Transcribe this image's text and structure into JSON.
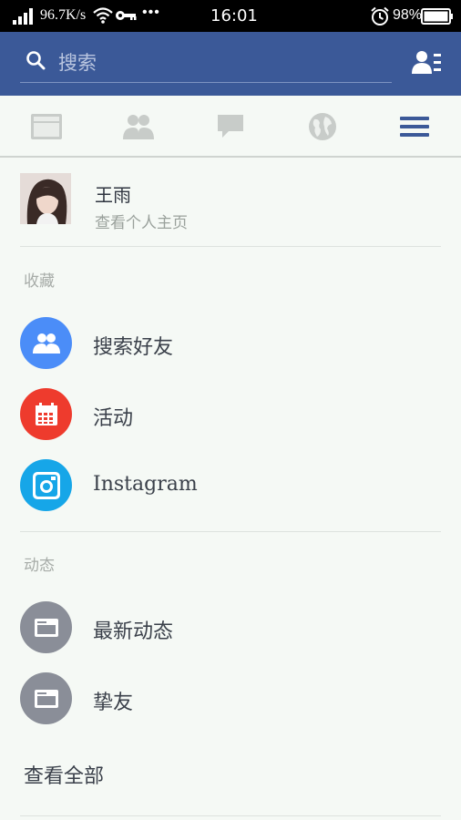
{
  "status_bar": {
    "speed": "96.7K/s",
    "dots": "•••",
    "time": "16:01",
    "battery_percent": "98%"
  },
  "header": {
    "search_placeholder": "搜索"
  },
  "tabs": [
    {
      "name": "news-feed",
      "icon": "news-feed-icon",
      "active": false
    },
    {
      "name": "friends",
      "icon": "friends-icon",
      "active": false
    },
    {
      "name": "messages",
      "icon": "chat-icon",
      "active": false
    },
    {
      "name": "notifications",
      "icon": "globe-icon",
      "active": false
    },
    {
      "name": "menu",
      "icon": "hamburger-menu-icon",
      "active": true
    }
  ],
  "profile": {
    "name": "王雨",
    "subtitle": "查看个人主页"
  },
  "sections": {
    "favorites_label": "收藏",
    "favorites": [
      {
        "label": "搜索好友",
        "icon": "find-friends-icon",
        "color": "#4b8df8"
      },
      {
        "label": "活动",
        "icon": "calendar-icon",
        "color": "#ee3b2d"
      },
      {
        "label": "Instagram",
        "icon": "instagram-icon",
        "color": "#16a6e8"
      }
    ],
    "feeds_label": "动态",
    "feeds": [
      {
        "label": "最新动态",
        "icon": "feed-icon",
        "color": "#8a8e98"
      },
      {
        "label": "挚友",
        "icon": "feed-icon",
        "color": "#8a8e98"
      }
    ],
    "see_all": "查看全部"
  },
  "colors": {
    "brand_blue": "#3b5998",
    "tab_active": "#3b5998",
    "tab_inactive": "#c8ccc9",
    "background": "#f5f9f5"
  }
}
